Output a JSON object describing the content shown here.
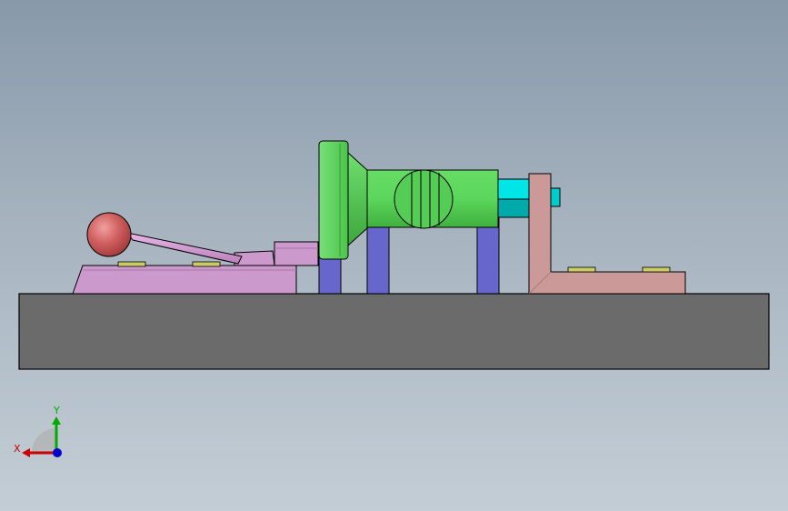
{
  "viewport": {
    "background_top": "#8899aa",
    "background_bottom": "#c3cdd5"
  },
  "model": {
    "parts": [
      {
        "name": "base-plate",
        "color": "#6b6b6b"
      },
      {
        "name": "toggle-clamp-base",
        "color": "#cc99cc"
      },
      {
        "name": "toggle-handle",
        "color": "#cc99cc"
      },
      {
        "name": "handle-knob",
        "color": "#cc5555"
      },
      {
        "name": "support-posts",
        "color": "#6666cc"
      },
      {
        "name": "flange",
        "color": "#55dd55"
      },
      {
        "name": "cylinder-body",
        "color": "#55dd55"
      },
      {
        "name": "pin",
        "color": "#00cccc"
      },
      {
        "name": "angle-bracket",
        "color": "#cc9999"
      },
      {
        "name": "bolt-heads",
        "color": "#cccc66"
      }
    ]
  },
  "triad": {
    "x_label": "X",
    "y_label": "Y",
    "x_color": "#cc0000",
    "y_color": "#00aa00",
    "z_color": "#0000cc"
  }
}
